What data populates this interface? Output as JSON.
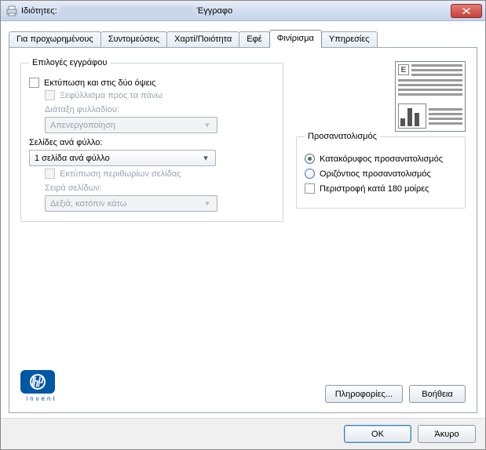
{
  "title": {
    "prefix": "Ιδιότητες:",
    "suffix": "Έγγραφο"
  },
  "tabs": [
    {
      "label": "Για προχωρημένους"
    },
    {
      "label": "Συντομεύσεις"
    },
    {
      "label": "Χαρτί/Ποιότητα"
    },
    {
      "label": "Εφέ"
    },
    {
      "label": "Φινίρισμα"
    },
    {
      "label": "Υπηρεσίες"
    }
  ],
  "docOptions": {
    "legend": "Επιλογές εγγράφου",
    "printBoth": "Εκτύπωση και στις δύο όψεις",
    "flipUp": "Ξεφύλλισμα προς τα πάνω",
    "bookletLabel": "Διάταξη φυλλαδίου:",
    "bookletValue": "Απενεργοποίηση",
    "pagesPerSheetLabel": "Σελίδες ανά φύλλο:",
    "pagesPerSheetValue": "1 σελίδα ανά φύλλο",
    "printBorders": "Εκτύπωση περιθωρίων σελίδας",
    "pageOrderLabel": "Σειρά σελίδων:",
    "pageOrderValue": "Δεξιά, κατόπιν κάτω"
  },
  "orientation": {
    "legend": "Προσανατολισμός",
    "portrait": "Κατακόρυφος προσανατολισμός",
    "landscape": "Οριζόντιος προσανατολισμός",
    "rotate": "Περιστροφή κατά 180 μοίρες"
  },
  "logo": {
    "brand": "invent"
  },
  "buttons": {
    "info": "Πληροφορίες...",
    "help": "Βοήθεια",
    "ok": "OK",
    "cancel": "Άκυρο"
  },
  "preview": {
    "corner": "E"
  }
}
